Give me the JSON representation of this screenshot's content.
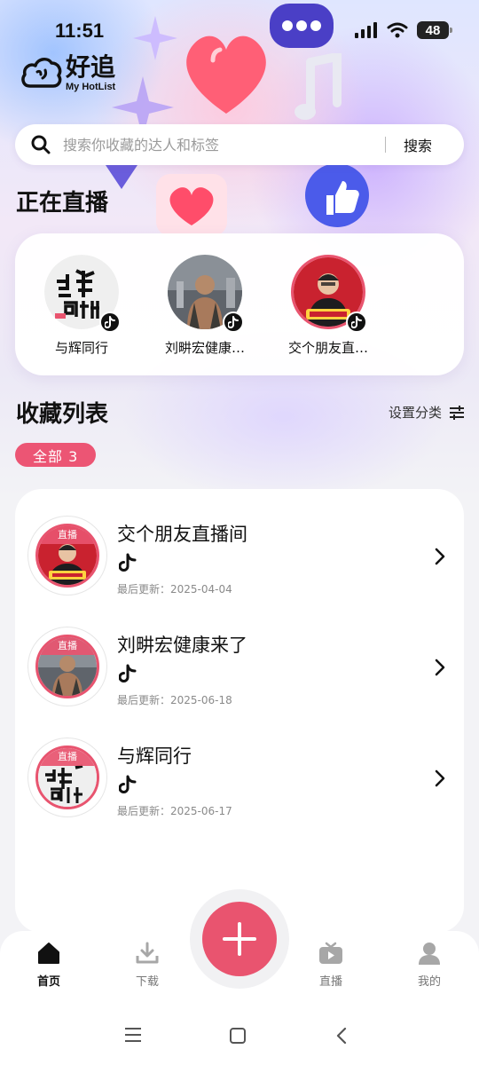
{
  "status_bar": {
    "time": "11:51",
    "battery": "48"
  },
  "app": {
    "name_cn": "好追",
    "name_en": "My HotList"
  },
  "search": {
    "placeholder": "搜索你收藏的达人和标签",
    "button_label": "搜索"
  },
  "live_section": {
    "title": "正在直播",
    "items": [
      {
        "name": "与辉同行",
        "avatar": "yuhui-logo"
      },
      {
        "name": "刘畊宏健康…",
        "avatar": "man-portrait"
      },
      {
        "name": "交个朋友直…",
        "avatar": "man-portrait-red"
      }
    ]
  },
  "favorites": {
    "title": "收藏列表",
    "settings_label": "设置分类",
    "filter_label": "全部 3",
    "live_tag": "直播",
    "items": [
      {
        "title": "交个朋友直播间",
        "platform": "tiktok-icon",
        "updated": "最后更新：2025-04-04"
      },
      {
        "title": "刘畊宏健康来了",
        "platform": "tiktok-icon",
        "updated": "最后更新：2025-06-18"
      },
      {
        "title": "与辉同行",
        "platform": "tiktok-icon",
        "updated": "最后更新：2025-06-17"
      }
    ]
  },
  "bottom_nav": {
    "items": [
      {
        "label": "首页",
        "icon": "home-icon",
        "active": true
      },
      {
        "label": "下载",
        "icon": "download-icon",
        "active": false
      },
      {
        "label": "直播",
        "icon": "tv-icon",
        "active": false
      },
      {
        "label": "我的",
        "icon": "profile-icon",
        "active": false
      }
    ],
    "fab_icon": "plus-icon"
  },
  "colors": {
    "accent": "#e9546f",
    "text": "#111111",
    "muted": "#8a8a8a"
  }
}
